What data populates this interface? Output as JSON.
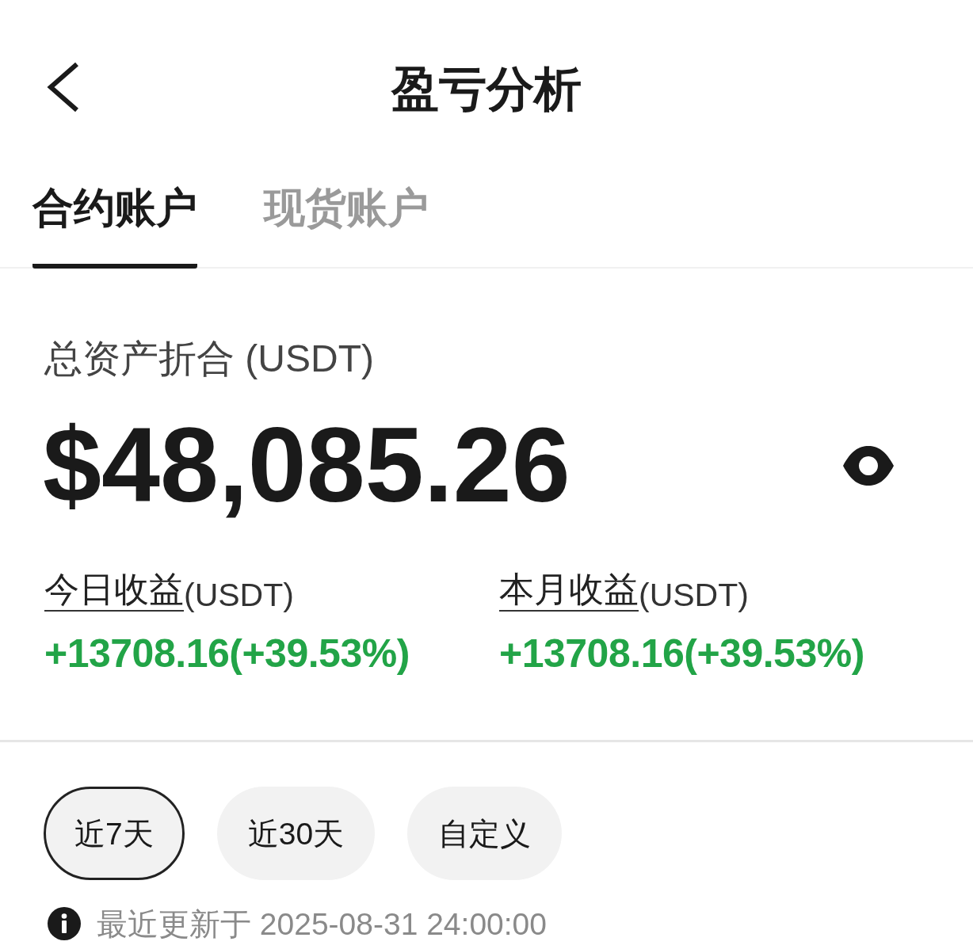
{
  "header": {
    "title": "盈亏分析"
  },
  "tabs": [
    {
      "label": "合约账户",
      "selected": true
    },
    {
      "label": "现货账户",
      "selected": false
    }
  ],
  "total": {
    "label": "总资产折合 (USDT)",
    "amount": "$48,085.26"
  },
  "stats": [
    {
      "label": "今日收益",
      "unit": "(USDT)",
      "value": "+13708.16(+39.53%)"
    },
    {
      "label": "本月收益",
      "unit": "(USDT)",
      "value": "+13708.16(+39.53%)"
    }
  ],
  "periods": [
    {
      "label": "近7天",
      "selected": true
    },
    {
      "label": "近30天",
      "selected": false
    },
    {
      "label": "自定义",
      "selected": false
    }
  ],
  "update": {
    "text": "最近更新于 2025-08-31 24:00:00"
  }
}
